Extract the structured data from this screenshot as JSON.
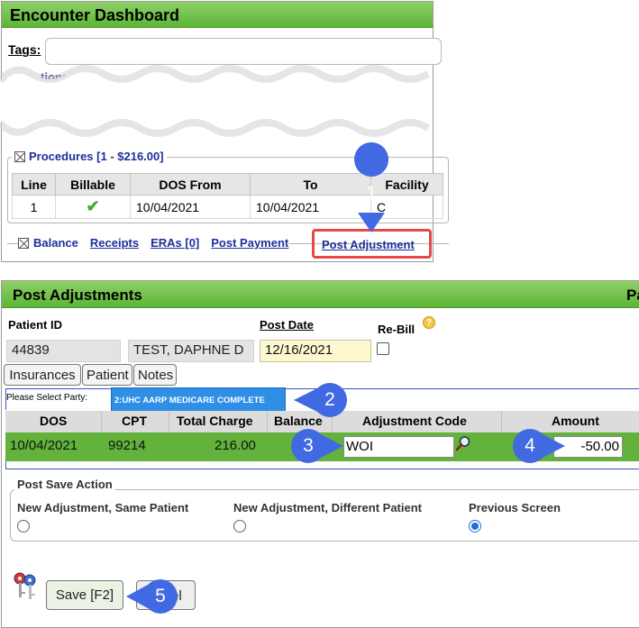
{
  "top_panel": {
    "title": "Encounter Dashboard",
    "tags_label": "Tags:",
    "partial_section_label": "tions",
    "procedures": {
      "legend": "Procedures [1 - $216.00]",
      "columns": [
        "Line",
        "Billable",
        "DOS From",
        "To",
        "Facility"
      ],
      "rows": [
        {
          "line": "1",
          "billable_icon": "check-icon",
          "dos_from": "10/04/2021",
          "to": "10/04/2021",
          "facility": "C"
        }
      ]
    },
    "balance_bar": {
      "label": "Balance",
      "links": [
        "Receipts",
        "ERAs [0]",
        "Post Payment"
      ],
      "post_adjustment": "Post Adjustment"
    }
  },
  "bottom_panel": {
    "title": "Post Adjustments",
    "title_right_partial": "Pa",
    "patient_id_label": "Patient ID",
    "patient_id": "44839",
    "patient_name": "TEST, DAPHNE D",
    "post_date_label": "Post Date",
    "post_date": "12/16/2021",
    "rebill_label": "Re-Bill",
    "rebill_checked": false,
    "tabs": [
      "Insurances",
      "Patient",
      "Notes"
    ],
    "party_label": "Please Select Party:",
    "party_selected": "2:UHC AARP MEDICARE COMPLETE",
    "adjustment_table": {
      "columns": [
        "DOS",
        "CPT",
        "Total Charge",
        "Balance",
        "Adjustment Code",
        "Amount"
      ],
      "row": {
        "dos": "10/04/2021",
        "cpt": "99214",
        "total_charge": "216.00",
        "balance": "",
        "adjustment_code": "WOI",
        "amount": "-50.00"
      }
    },
    "post_save_action": {
      "legend": "Post Save Action",
      "options": [
        {
          "label": "New Adjustment, Same Patient",
          "selected": false
        },
        {
          "label": "New Adjustment, Different Patient",
          "selected": false
        },
        {
          "label": "Previous Screen",
          "selected": true
        }
      ]
    },
    "save_label": "Save [F2]",
    "cancel_partial": "el"
  },
  "callouts": [
    "1",
    "2",
    "3",
    "4",
    "5"
  ],
  "colors": {
    "title_bar_green": "#5cb535",
    "row_green": "#62b23c",
    "link_blue": "#1d2f9a",
    "callout_blue": "#4169e1",
    "party_select_blue": "#2f8ee6",
    "highlight_red": "#e54848",
    "date_field_yellow": "#fdf8cf"
  }
}
